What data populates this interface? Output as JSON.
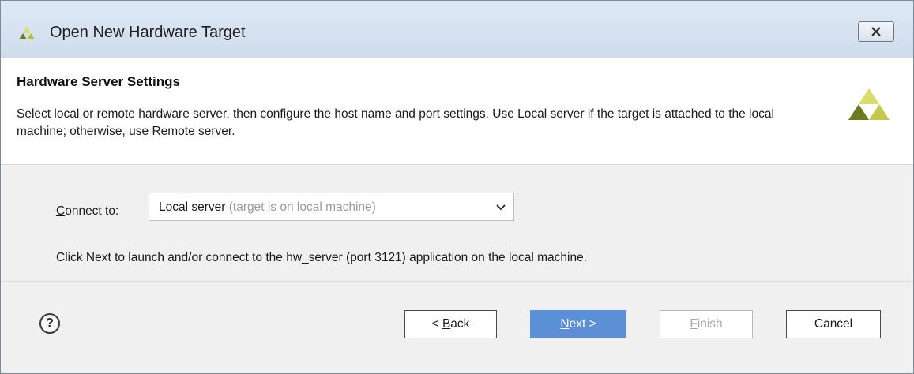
{
  "window": {
    "title": "Open New Hardware Target",
    "logo_icon": "xilinx-logo-icon",
    "close_icon": "close-icon"
  },
  "header": {
    "title": "Hardware Server Settings",
    "description": "Select local or remote hardware server, then configure the host name and port settings. Use Local server if the target is attached to the local machine; otherwise, use Remote server.",
    "logo_icon": "xilinx-logo-icon"
  },
  "connect": {
    "label_mnemonic": "C",
    "label_rest": "onnect to:",
    "selected_value": "Local server",
    "selected_hint": " (target is on local machine)",
    "dropdown_icon": "chevron-down-icon"
  },
  "info": {
    "text": "Click Next to launch and/or connect to the hw_server (port 3121) application on the local machine."
  },
  "footer": {
    "help_label": "?",
    "back_prefix": "< ",
    "back_mnemonic": "B",
    "back_rest": "ack",
    "next_mnemonic": "N",
    "next_rest": "ext >",
    "finish_mnemonic": "F",
    "finish_rest": "inish",
    "cancel_label": "Cancel"
  },
  "colors": {
    "next_button": "#5b8fd6",
    "logo_dark": "#6b7a1e",
    "logo_light": "#d8dd6a"
  }
}
